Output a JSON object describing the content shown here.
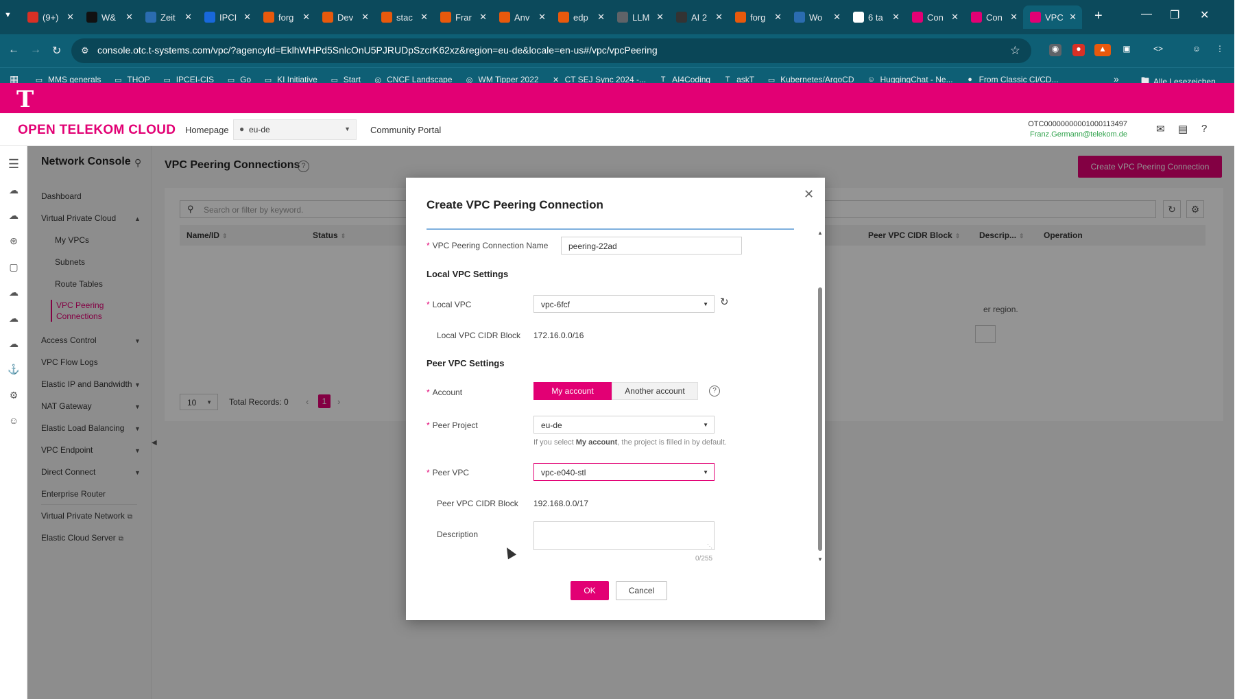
{
  "browser": {
    "tabs": [
      {
        "label": "(9+)",
        "favicon": "mail",
        "color": "#d93025"
      },
      {
        "label": "W&",
        "favicon": "W",
        "color": "#111111"
      },
      {
        "label": "Zeit",
        "favicon": "C",
        "color": "#2b6cb0"
      },
      {
        "label": "IPCI",
        "favicon": "confluence",
        "color": "#1868db"
      },
      {
        "label": "forg",
        "favicon": "F",
        "color": "#e8590c"
      },
      {
        "label": "Dev",
        "favicon": "F",
        "color": "#e8590c"
      },
      {
        "label": "stac",
        "favicon": "F",
        "color": "#e8590c"
      },
      {
        "label": "Frar",
        "favicon": "F",
        "color": "#e8590c"
      },
      {
        "label": "Anv",
        "favicon": "F",
        "color": "#e8590c"
      },
      {
        "label": "edp",
        "favicon": "F",
        "color": "#e8590c"
      },
      {
        "label": "LLM",
        "favicon": "share",
        "color": "#5f6368"
      },
      {
        "label": "AI 2",
        "favicon": "27",
        "color": "#333333"
      },
      {
        "label": "forg",
        "favicon": "F",
        "color": "#e8590c"
      },
      {
        "label": "Wo",
        "favicon": "S",
        "color": "#2b6cb0"
      },
      {
        "label": "6 ta",
        "favicon": "G",
        "color": "#ffffff"
      },
      {
        "label": "Con",
        "favicon": "T",
        "color": "#e20074"
      },
      {
        "label": "Con",
        "favicon": "T",
        "color": "#e20074"
      },
      {
        "label": "VPC",
        "favicon": "T",
        "color": "#e20074"
      }
    ],
    "url": "console.otc.t-systems.com/vpc/?agencyId=EklhWHPd5SnlcOnU5PJRUDpSzcrK62xz&region=eu-de&locale=en-us#/vpc/vpcPeering",
    "bookmarks": [
      {
        "label": "MMS generals",
        "icon": "folder"
      },
      {
        "label": "THOP",
        "icon": "folder"
      },
      {
        "label": "IPCEI-CIS",
        "icon": "folder"
      },
      {
        "label": "Go",
        "icon": "folder"
      },
      {
        "label": "KI Initiative",
        "icon": "folder"
      },
      {
        "label": "Start",
        "icon": "folder"
      },
      {
        "label": "CNCF Landscape",
        "icon": "globe"
      },
      {
        "label": "WM Tipper 2022",
        "icon": "globe"
      },
      {
        "label": "CT SEJ Sync 2024 -...",
        "icon": "jira"
      },
      {
        "label": "AI4Coding",
        "icon": "tmobile"
      },
      {
        "label": "askT",
        "icon": "tmobile"
      },
      {
        "label": "Kubernetes/ArgoCD",
        "icon": "folder"
      },
      {
        "label": "HuggingChat - Ne...",
        "icon": "hf"
      },
      {
        "label": "From Classic CI/CD...",
        "icon": "github"
      }
    ],
    "all_bookmarks": "Alle Lesezeichen"
  },
  "header": {
    "brand": "OPEN TELEKOM CLOUD",
    "homepage": "Homepage",
    "region": "eu-de",
    "community": "Community Portal",
    "account_id": "OTC00000000001000113497",
    "account_email": "Franz.Germann@telekom.de"
  },
  "sidebar": {
    "title": "Network Console",
    "items": {
      "dashboard": "Dashboard",
      "vpc": "Virtual Private Cloud",
      "my_vpcs": "My VPCs",
      "subnets": "Subnets",
      "route_tables": "Route Tables",
      "vpc_peering_1": "VPC Peering",
      "vpc_peering_2": "Connections",
      "access_control": "Access Control",
      "flow_logs": "VPC Flow Logs",
      "eip": "Elastic IP and Bandwidth",
      "nat": "NAT Gateway",
      "elb": "Elastic Load Balancing",
      "endpoint": "VPC Endpoint",
      "direct_connect": "Direct Connect",
      "enterprise_router": "Enterprise Router",
      "vpn": "Virtual Private Network",
      "ecs": "Elastic Cloud Server"
    }
  },
  "main": {
    "title": "VPC Peering Connections",
    "create_button": "Create VPC Peering Connection",
    "search_placeholder": "Search or filter by keyword.",
    "columns": {
      "name": "Name/ID",
      "status": "Status",
      "peer_cidr": "Peer VPC CIDR Block",
      "descr": "Descrip...",
      "operation": "Operation"
    },
    "empty_fragment": "er region.",
    "page_size": "10",
    "total": "Total Records: 0",
    "current_page": "1"
  },
  "modal": {
    "title": "Create VPC Peering Connection",
    "name_label": "VPC Peering Connection Name",
    "name_value": "peering-22ad",
    "local_section": "Local VPC Settings",
    "local_vpc_label": "Local VPC",
    "local_vpc_value": "vpc-6fcf",
    "local_cidr_label": "Local VPC CIDR Block",
    "local_cidr_value": "172.16.0.0/16",
    "peer_section": "Peer VPC Settings",
    "account_label": "Account",
    "account_my": "My account",
    "account_other": "Another account",
    "peer_project_label": "Peer Project",
    "peer_project_value": "eu-de",
    "hint_prefix": "If you select ",
    "hint_bold": "My account",
    "hint_suffix": ", the project is filled in by default.",
    "peer_vpc_label": "Peer VPC",
    "peer_vpc_value": "vpc-e040-stl",
    "peer_cidr_label": "Peer VPC CIDR Block",
    "peer_cidr_value": "192.168.0.0/17",
    "description_label": "Description",
    "description_count": "0/255",
    "ok": "OK",
    "cancel": "Cancel"
  },
  "colors": {
    "brand_magenta": "#e20074",
    "browser_teal": "#0e5f75"
  }
}
